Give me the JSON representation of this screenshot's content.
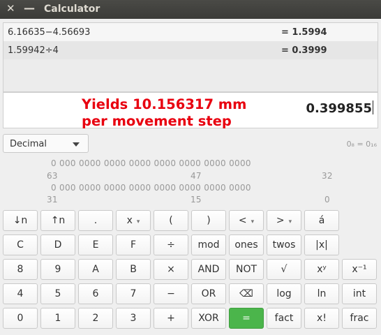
{
  "window": {
    "title": "Calculator",
    "close_glyph": "✕",
    "minimize_glyph": "—"
  },
  "history": [
    {
      "expr": "6.16635−4.56693",
      "result": "= 1.5994"
    },
    {
      "expr": "1.59942÷4",
      "result": "= 0.3999"
    }
  ],
  "annotation": {
    "line1": "Yields 10.156317 mm",
    "line2": "per movement step",
    "color": "#e8000f"
  },
  "entry": {
    "value": "0.399855"
  },
  "mode": {
    "selected": "Decimal"
  },
  "base_indicator": "0₈ = 0₁₆",
  "bits": {
    "row1": "0 000  0000  0000  0000  0000  0000  0000  0000",
    "row1_labels": [
      "63",
      "47",
      "32"
    ],
    "row2": "0 000  0000  0000  0000  0000  0000  0000  0000",
    "row2_labels": [
      "31",
      "15",
      "0"
    ]
  },
  "keypad": [
    [
      "↓n",
      "↑n",
      ".",
      "x",
      "(",
      ")",
      "<",
      ">",
      "á"
    ],
    [
      "C",
      "D",
      "E",
      "F",
      "÷",
      "mod",
      "ones",
      "twos",
      "|x|"
    ],
    [
      "8",
      "9",
      "A",
      "B",
      "×",
      "AND",
      "NOT",
      "√",
      "xʸ",
      "x⁻¹"
    ],
    [
      "4",
      "5",
      "6",
      "7",
      "−",
      "OR",
      "⌫",
      "log",
      "ln",
      "int"
    ],
    [
      "0",
      "1",
      "2",
      "3",
      "+",
      "XOR",
      "=",
      "fact",
      "x!",
      "frac"
    ]
  ],
  "colors": {
    "equals": "#4bb54b",
    "titlebar": "#3c3b37"
  }
}
